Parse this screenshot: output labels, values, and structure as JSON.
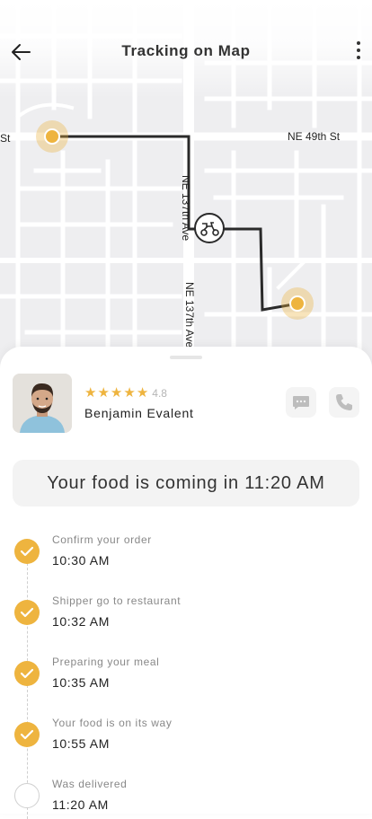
{
  "header": {
    "title": "Tracking on Map",
    "back_icon": "arrow-left-icon",
    "more_icon": "more-vertical-icon"
  },
  "map": {
    "streets": [
      "NE 49th St",
      "St",
      "NE 137th Ave",
      "NE 137th Ave"
    ],
    "route_color": "#2a2a2a",
    "pin_color": "#EEB43F"
  },
  "driver": {
    "name": "Benjamin Evalent",
    "rating": "4.8",
    "stars": 5,
    "chat_icon": "chat-icon",
    "call_icon": "phone-icon"
  },
  "eta": {
    "text": "Your food is coming in 11:20 AM"
  },
  "steps": [
    {
      "label": "Confirm your order",
      "time": "10:30 AM",
      "done": true
    },
    {
      "label": "Shipper go to restaurant",
      "time": "10:32 AM",
      "done": true
    },
    {
      "label": "Preparing your meal",
      "time": "10:35 AM",
      "done": true
    },
    {
      "label": "Your food is on its way",
      "time": "10:55 AM",
      "done": true
    },
    {
      "label": "Was delivered",
      "time": "11:20 AM",
      "done": false
    }
  ],
  "colors": {
    "accent": "#EEB43F",
    "map_bg": "#eeeef0",
    "road": "#ffffff"
  }
}
